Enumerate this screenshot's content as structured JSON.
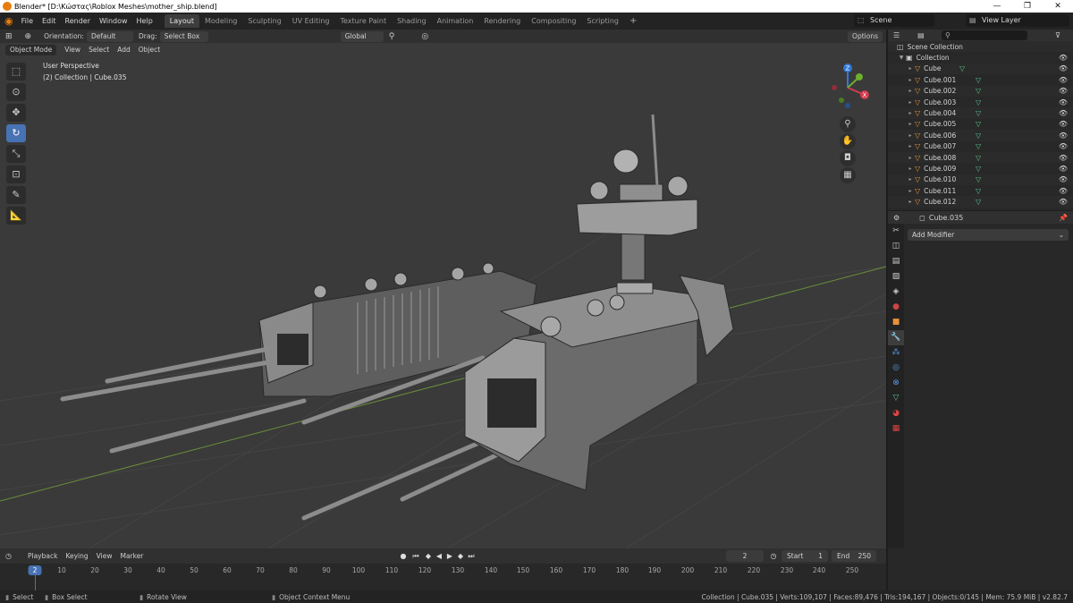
{
  "window": {
    "title": "Blender* [D:\\Κώστας\\Roblox Meshes\\mother_ship.blend]",
    "controls": [
      "—",
      "❐",
      "✕"
    ]
  },
  "menu": [
    "File",
    "Edit",
    "Render",
    "Window",
    "Help"
  ],
  "workspaces": [
    "Layout",
    "Modeling",
    "Sculpting",
    "UV Editing",
    "Texture Paint",
    "Shading",
    "Animation",
    "Rendering",
    "Compositing",
    "Scripting"
  ],
  "active_workspace": "Layout",
  "scene": "Scene",
  "view_layer": "View Layer",
  "viewport_header": {
    "orientation_label": "Orientation:",
    "orientation_value": "Default",
    "drag_label": "Drag:",
    "drag_value": "Select Box",
    "transform_orientation": "Global",
    "options": "Options"
  },
  "viewport_sub": {
    "mode": "Object Mode",
    "menus": [
      "View",
      "Select",
      "Add",
      "Object"
    ]
  },
  "viewport_info": {
    "perspective": "User Perspective",
    "collection": "(2) Collection | Cube.035"
  },
  "gizmo_axes": [
    "Z",
    "X",
    "Y"
  ],
  "outliner": {
    "root": "Scene Collection",
    "collection": "Collection",
    "objects": [
      "Cube",
      "Cube.001",
      "Cube.002",
      "Cube.003",
      "Cube.004",
      "Cube.005",
      "Cube.006",
      "Cube.007",
      "Cube.008",
      "Cube.009",
      "Cube.010",
      "Cube.011",
      "Cube.012"
    ]
  },
  "properties": {
    "object": "Cube.035",
    "add_modifier": "Add Modifier"
  },
  "timeline": {
    "menus": [
      "Playback",
      "Keying",
      "View",
      "Marker"
    ],
    "current_frame": "2",
    "start_label": "Start",
    "start": "1",
    "end_label": "End",
    "end": "250",
    "ticks": [
      "10",
      "20",
      "30",
      "40",
      "50",
      "60",
      "70",
      "80",
      "90",
      "100",
      "110",
      "120",
      "130",
      "140",
      "150",
      "160",
      "170",
      "180",
      "190",
      "200",
      "210",
      "220",
      "230",
      "240",
      "250"
    ],
    "cursor": "2"
  },
  "statusbar": {
    "select": "Select",
    "box_select": "Box Select",
    "rotate_view": "Rotate View",
    "context_menu": "Object Context Menu",
    "stats": "Collection | Cube.035 | Verts:109,107 | Faces:89,476 | Tris:194,167 | Objects:0/145 | Mem: 75.9 MiB | v2.82.7"
  },
  "colors": {
    "accent": "#4772b3",
    "mesh_icon": "#e8913a",
    "data_icon": "#5cc18b",
    "x_axis": "#d13b4f",
    "y_axis": "#6fae2f",
    "z_axis": "#2f78d6"
  }
}
